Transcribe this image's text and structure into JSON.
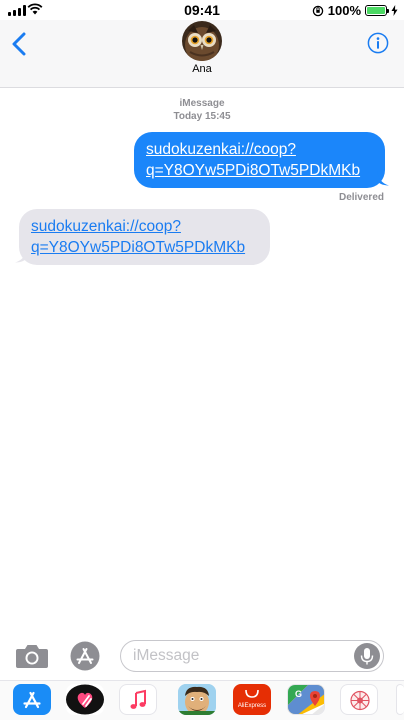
{
  "status_bar": {
    "time": "09:41",
    "battery_percent": "100%",
    "battery_level": 1.0
  },
  "header": {
    "contact_name": "Ana",
    "back_icon": "chevron-left-icon",
    "info_icon": "info-icon"
  },
  "conversation": {
    "service": "iMessage",
    "timestamp": "Today 15:45",
    "messages": [
      {
        "direction": "outgoing",
        "text": "sudokuzenkai://coop?q=Y8OYw5PDi8OTw5PDkMKb",
        "line1": "sudokuzenkai://coop?",
        "line2": "q=Y8OYw5PDi8OTw5PDkMKb"
      },
      {
        "direction": "incoming",
        "text": "sudokuzenkai://coop?q=Y8OYw5PDi8OTw5PDkMKb",
        "line1": "sudokuzenkai://coop?",
        "line2": "q=Y8OYw5PDi8OTw5PDkMKb"
      }
    ],
    "delivery_status": "Delivered"
  },
  "composer": {
    "placeholder": "iMessage",
    "value": ""
  },
  "app_drawer": {
    "apps": [
      {
        "name": "App Store",
        "icon": "app-store-icon"
      },
      {
        "name": "Digital Touch",
        "icon": "digital-touch-icon"
      },
      {
        "name": "Music",
        "icon": "music-icon"
      },
      {
        "name": "Animoji",
        "icon": "animoji-icon"
      },
      {
        "name": "AliExpress",
        "icon": "aliexpress-icon",
        "label": "AliExpress"
      },
      {
        "name": "Google Maps",
        "icon": "google-maps-icon"
      },
      {
        "name": "Sudoku",
        "icon": "sudoku-icon"
      }
    ]
  },
  "colors": {
    "outgoing_bubble": "#1b86fa",
    "incoming_bubble": "#e6e5eb",
    "accent": "#1a7cf1"
  }
}
